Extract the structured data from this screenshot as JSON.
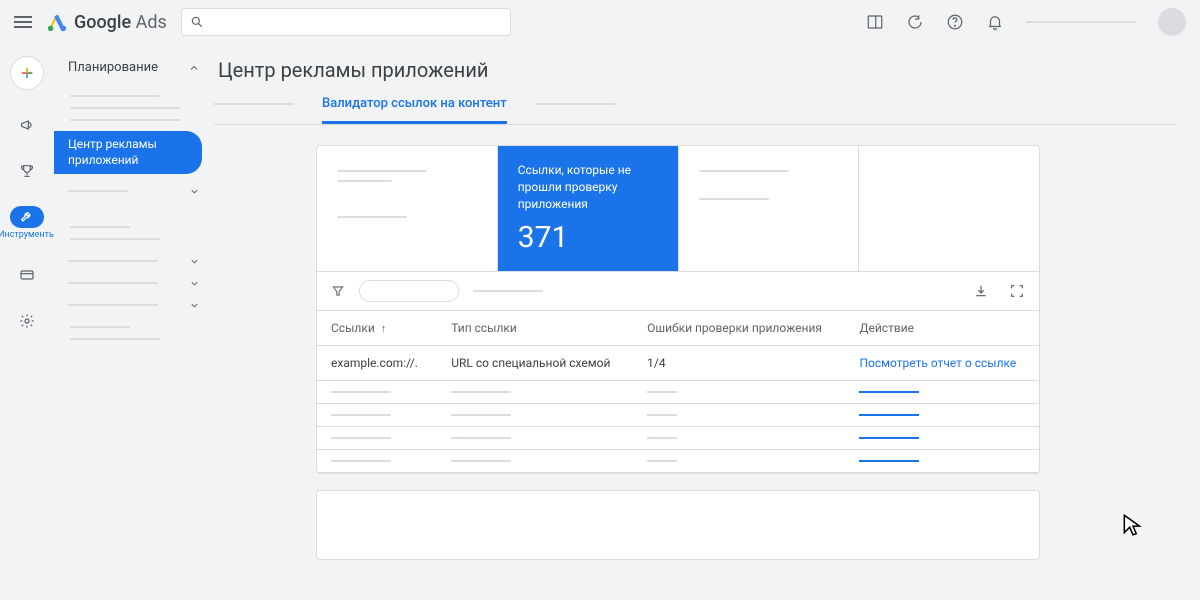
{
  "brand": {
    "name1": "Google",
    "name2": "Ads"
  },
  "sidebar": {
    "heading": "Планирование",
    "active_item": "Центр рекламы приложений"
  },
  "rail": {
    "tools_label": "Инструменты"
  },
  "page": {
    "title": "Центр рекламы приложений",
    "active_tab": "Валидатор ссылок на контент"
  },
  "stat_card": {
    "label": "Ссылки, которые не прошли проверку приложения",
    "value": "371"
  },
  "table": {
    "headers": {
      "links": "Ссылки",
      "type": "Тип ссылки",
      "errors": "Ошибки проверки приложения",
      "action": "Действие"
    },
    "row": {
      "link": "example.com://.",
      "type": "URL со специальной схемой",
      "errors": "1/4",
      "action": "Посмотреть отчет о ссылке"
    }
  }
}
